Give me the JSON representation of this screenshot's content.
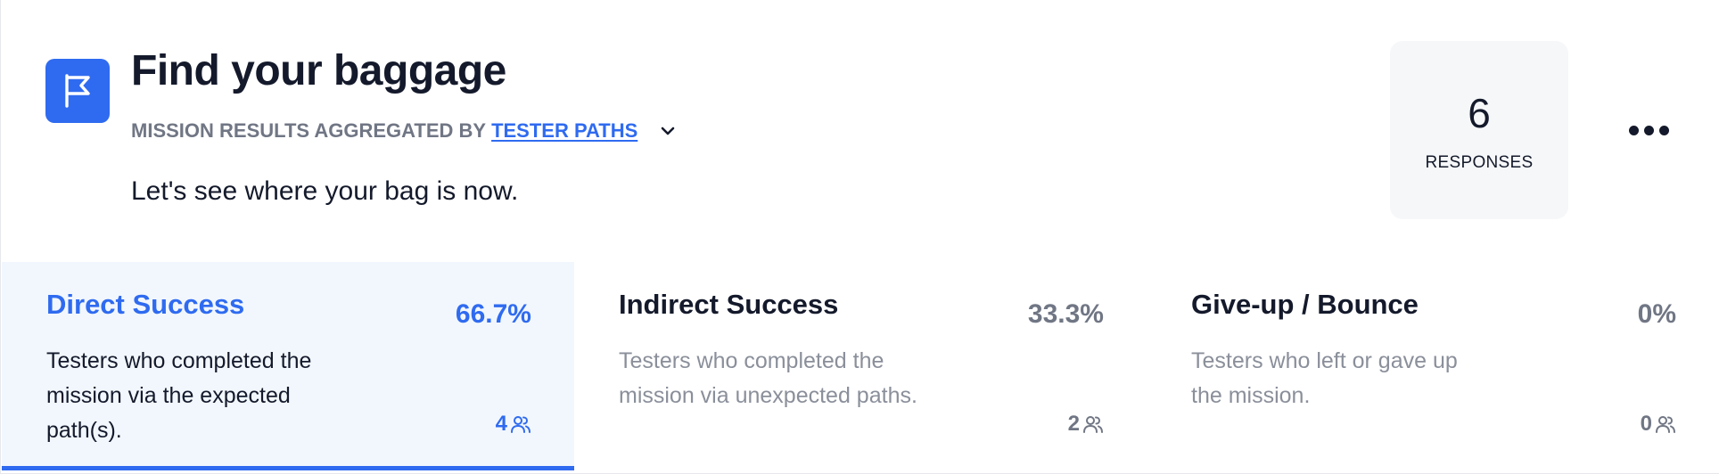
{
  "header": {
    "title": "Find your baggage",
    "subtitle_prefix": "MISSION RESULTS AGGREGATED BY",
    "subtitle_link": "TESTER PATHS",
    "description": "Let's see where your bag is now.",
    "icon": "flag-icon"
  },
  "responses": {
    "count": "6",
    "label": "RESPONSES"
  },
  "menu": {
    "icon": "more-horizontal-icon"
  },
  "cards": [
    {
      "title": "Direct Success",
      "percent": "66.7%",
      "description": "Testers who completed the mission via the expected path(s).",
      "count": "4",
      "active": true
    },
    {
      "title": "Indirect Success",
      "percent": "33.3%",
      "description": "Testers who completed the mission via unexpected paths.",
      "count": "2",
      "active": false
    },
    {
      "title": "Give-up / Bounce",
      "percent": "0%",
      "description": "Testers who left or gave up the mission.",
      "count": "0",
      "active": false
    }
  ],
  "colors": {
    "accent": "#2f6bf0",
    "active_card_bg": "#f2f7fd",
    "muted_text": "#707684",
    "dark_text": "#141a2b"
  }
}
